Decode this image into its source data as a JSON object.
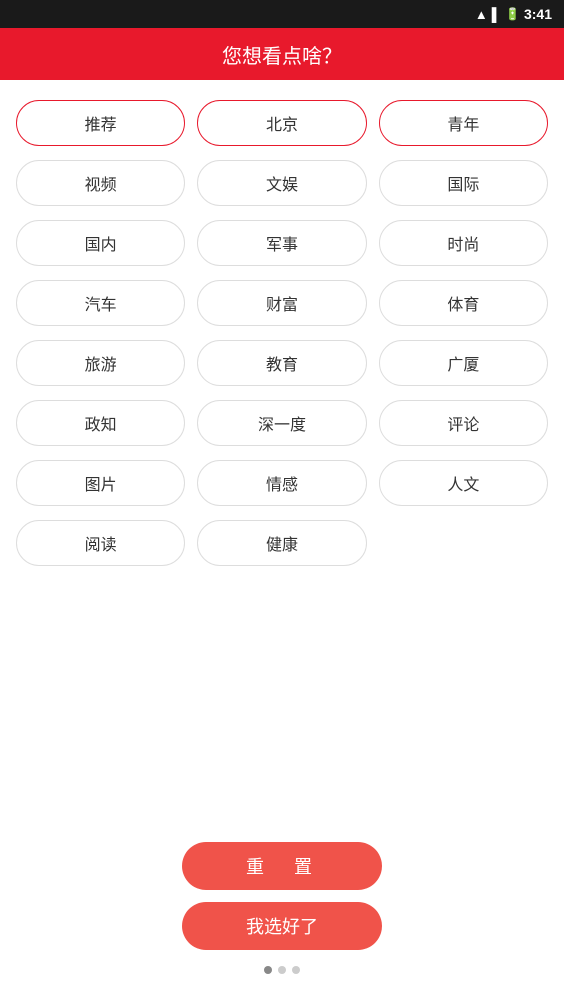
{
  "statusBar": {
    "time": "3:41"
  },
  "header": {
    "title": "您想看点啥？"
  },
  "tags": [
    {
      "id": "tuijian",
      "label": "推荐",
      "selected": true
    },
    {
      "id": "beijing",
      "label": "北京",
      "selected": true
    },
    {
      "id": "qingnian",
      "label": "青年",
      "selected": true
    },
    {
      "id": "shipin",
      "label": "视频",
      "selected": false
    },
    {
      "id": "wenyu",
      "label": "文娱",
      "selected": false
    },
    {
      "id": "guoji",
      "label": "国际",
      "selected": false
    },
    {
      "id": "guonei",
      "label": "国内",
      "selected": false
    },
    {
      "id": "junshi",
      "label": "军事",
      "selected": false
    },
    {
      "id": "shishang",
      "label": "时尚",
      "selected": false
    },
    {
      "id": "qiche",
      "label": "汽车",
      "selected": false
    },
    {
      "id": "caifu",
      "label": "财富",
      "selected": false
    },
    {
      "id": "tiyu",
      "label": "体育",
      "selected": false
    },
    {
      "id": "lvyou",
      "label": "旅游",
      "selected": false
    },
    {
      "id": "jiaoyu",
      "label": "教育",
      "selected": false
    },
    {
      "id": "guangsha",
      "label": "广厦",
      "selected": false
    },
    {
      "id": "zhengzhi",
      "label": "政知",
      "selected": false
    },
    {
      "id": "shengyidu",
      "label": "深一度",
      "selected": false
    },
    {
      "id": "pinglun",
      "label": "评论",
      "selected": false
    },
    {
      "id": "tupian",
      "label": "图片",
      "selected": false
    },
    {
      "id": "qinggan",
      "label": "情感",
      "selected": false
    },
    {
      "id": "renwen",
      "label": "人文",
      "selected": false
    },
    {
      "id": "yuedu",
      "label": "阅读",
      "selected": false
    },
    {
      "id": "jiankang",
      "label": "健康",
      "selected": false
    }
  ],
  "buttons": {
    "reset": "重　置",
    "confirm": "我选好了"
  },
  "pagination": {
    "dots": 3,
    "active": 0
  }
}
